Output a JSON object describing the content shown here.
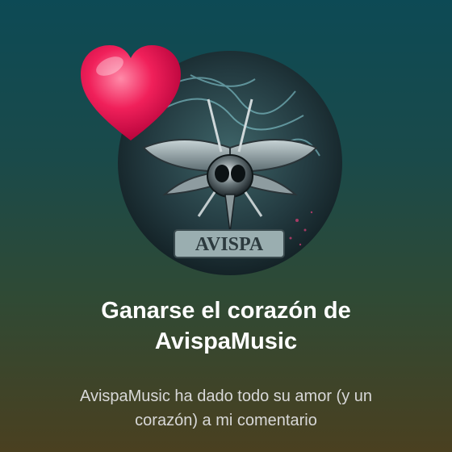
{
  "achievement": {
    "title_line1": "Ganarse el corazón de",
    "title_line2": "AvispaMusic",
    "description_line1": "AvispaMusic ha dado todo su amor (y un",
    "description_line2": "corazón) a mi comentario"
  },
  "avatar": {
    "logo_text": "AVISPA",
    "icon": "wasp-logo"
  },
  "badge": {
    "icon": "heart-icon",
    "color": "#f0205a"
  },
  "colors": {
    "bg_top": "#0d4a55",
    "bg_bottom": "#4a4020",
    "title": "#ffffff",
    "description": "#d8d8d8"
  }
}
